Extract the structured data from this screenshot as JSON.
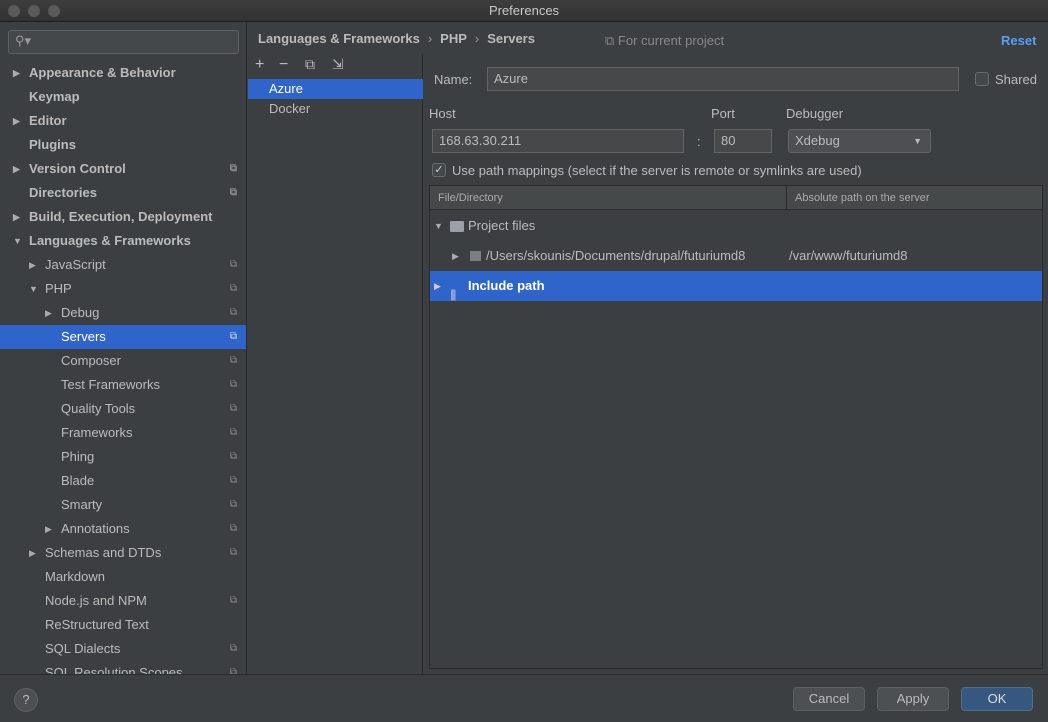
{
  "window": {
    "title": "Preferences"
  },
  "search": {
    "icon": "search-icon"
  },
  "sidebar": {
    "items": [
      {
        "label": "Appearance & Behavior",
        "level": 0,
        "bold": true,
        "arrow": "right"
      },
      {
        "label": "Keymap",
        "level": 0,
        "bold": true
      },
      {
        "label": "Editor",
        "level": 0,
        "bold": true,
        "arrow": "right"
      },
      {
        "label": "Plugins",
        "level": 0,
        "bold": true
      },
      {
        "label": "Version Control",
        "level": 0,
        "bold": true,
        "arrow": "right",
        "project": true
      },
      {
        "label": "Directories",
        "level": 0,
        "bold": true,
        "project": true
      },
      {
        "label": "Build, Execution, Deployment",
        "level": 0,
        "bold": true,
        "arrow": "right"
      },
      {
        "label": "Languages & Frameworks",
        "level": 0,
        "bold": true,
        "arrow": "down"
      },
      {
        "label": "JavaScript",
        "level": 1,
        "arrow": "right",
        "project": true
      },
      {
        "label": "PHP",
        "level": 1,
        "arrow": "down",
        "project": true
      },
      {
        "label": "Debug",
        "level": 2,
        "arrow": "right",
        "project": true
      },
      {
        "label": "Servers",
        "level": 2,
        "project": true,
        "selected": true
      },
      {
        "label": "Composer",
        "level": 2,
        "project": true
      },
      {
        "label": "Test Frameworks",
        "level": 2,
        "project": true
      },
      {
        "label": "Quality Tools",
        "level": 2,
        "project": true
      },
      {
        "label": "Frameworks",
        "level": 2,
        "project": true
      },
      {
        "label": "Phing",
        "level": 2,
        "project": true
      },
      {
        "label": "Blade",
        "level": 2,
        "project": true
      },
      {
        "label": "Smarty",
        "level": 2,
        "project": true
      },
      {
        "label": "Annotations",
        "level": 2,
        "arrow": "right",
        "project": true
      },
      {
        "label": "Schemas and DTDs",
        "level": 1,
        "arrow": "right",
        "project": true
      },
      {
        "label": "Markdown",
        "level": 1
      },
      {
        "label": "Node.js and NPM",
        "level": 1,
        "project": true
      },
      {
        "label": "ReStructured Text",
        "level": 1
      },
      {
        "label": "SQL Dialects",
        "level": 1,
        "project": true
      },
      {
        "label": "SQL Resolution Scopes",
        "level": 1,
        "project": true
      }
    ]
  },
  "breadcrumb": {
    "items": [
      "Languages & Frameworks",
      "PHP",
      "Servers"
    ],
    "scope": "For current project",
    "reset": "Reset"
  },
  "servers": {
    "items": [
      "Azure",
      "Docker"
    ],
    "selected": "Azure"
  },
  "form": {
    "name_label": "Name:",
    "name": "Azure",
    "shared_label": "Shared",
    "shared": false,
    "host_label": "Host",
    "host": "168.63.30.211",
    "port_label": "Port",
    "port": "80",
    "colon": ":",
    "debugger_label": "Debugger",
    "debugger": "Xdebug",
    "use_path_mappings": true,
    "use_path_mappings_label": "Use path mappings (select if the server is remote or symlinks are used)"
  },
  "mappings": {
    "columns": [
      "File/Directory",
      "Absolute path on the server"
    ],
    "rows": [
      {
        "label": "Project files",
        "server": ""
      },
      {
        "label": "/Users/skounis/Documents/drupal/futuriumd8",
        "server": "/var/www/futuriumd8"
      },
      {
        "label": "Include path",
        "server": ""
      }
    ]
  },
  "footer": {
    "help": "?",
    "cancel": "Cancel",
    "apply": "Apply",
    "ok": "OK"
  },
  "colors": {
    "accent": "#2f65ca",
    "link": "#589df6",
    "background": "#3c3f41"
  }
}
